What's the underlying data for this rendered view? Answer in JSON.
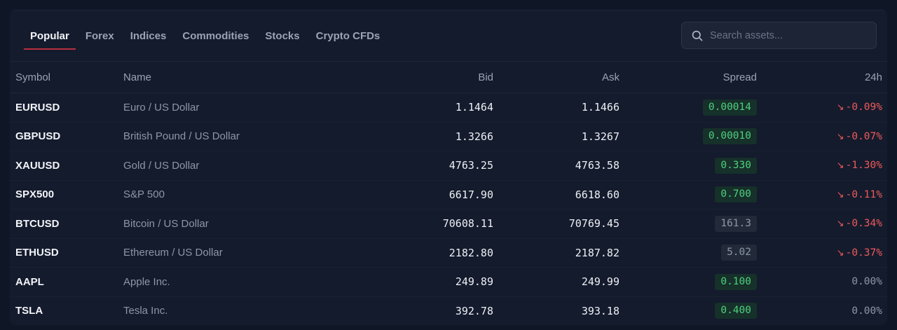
{
  "tabs": [
    {
      "label": "Popular",
      "active": true
    },
    {
      "label": "Forex"
    },
    {
      "label": "Indices"
    },
    {
      "label": "Commodities"
    },
    {
      "label": "Stocks"
    },
    {
      "label": "Crypto CFDs"
    }
  ],
  "search": {
    "placeholder": "Search assets...",
    "icon": "search-icon"
  },
  "table": {
    "headers": {
      "symbol": "Symbol",
      "name": "Name",
      "bid": "Bid",
      "ask": "Ask",
      "spread": "Spread",
      "change": "24h"
    },
    "rows": [
      {
        "symbol": "EURUSD",
        "name": "Euro / US Dollar",
        "bid": "1.1464",
        "ask": "1.1466",
        "spread": "0.00014",
        "spread_tone": "green",
        "change": "-0.09%",
        "direction": "down"
      },
      {
        "symbol": "GBPUSD",
        "name": "British Pound / US Dollar",
        "bid": "1.3266",
        "ask": "1.3267",
        "spread": "0.00010",
        "spread_tone": "green",
        "change": "-0.07%",
        "direction": "down"
      },
      {
        "symbol": "XAUUSD",
        "name": "Gold / US Dollar",
        "bid": "4763.25",
        "ask": "4763.58",
        "spread": "0.330",
        "spread_tone": "green",
        "change": "-1.30%",
        "direction": "down"
      },
      {
        "symbol": "SPX500",
        "name": "S&P 500",
        "bid": "6617.90",
        "ask": "6618.60",
        "spread": "0.700",
        "spread_tone": "green",
        "change": "-0.11%",
        "direction": "down"
      },
      {
        "symbol": "BTCUSD",
        "name": "Bitcoin / US Dollar",
        "bid": "70608.11",
        "ask": "70769.45",
        "spread": "161.3",
        "spread_tone": "gray",
        "change": "-0.34%",
        "direction": "down"
      },
      {
        "symbol": "ETHUSD",
        "name": "Ethereum / US Dollar",
        "bid": "2182.80",
        "ask": "2187.82",
        "spread": "5.02",
        "spread_tone": "gray",
        "change": "-0.37%",
        "direction": "down"
      },
      {
        "symbol": "AAPL",
        "name": "Apple Inc.",
        "bid": "249.89",
        "ask": "249.99",
        "spread": "0.100",
        "spread_tone": "green",
        "change": "0.00%",
        "direction": "flat"
      },
      {
        "symbol": "TSLA",
        "name": "Tesla Inc.",
        "bid": "392.78",
        "ask": "393.18",
        "spread": "0.400",
        "spread_tone": "green",
        "change": "0.00%",
        "direction": "flat"
      }
    ]
  },
  "colors": {
    "background": "#0f1626",
    "panel": "#141b2d",
    "accent_underline": "#b8303f",
    "positive": "#4fd07e",
    "negative": "#ef5a5a",
    "muted": "#8d96a7"
  }
}
